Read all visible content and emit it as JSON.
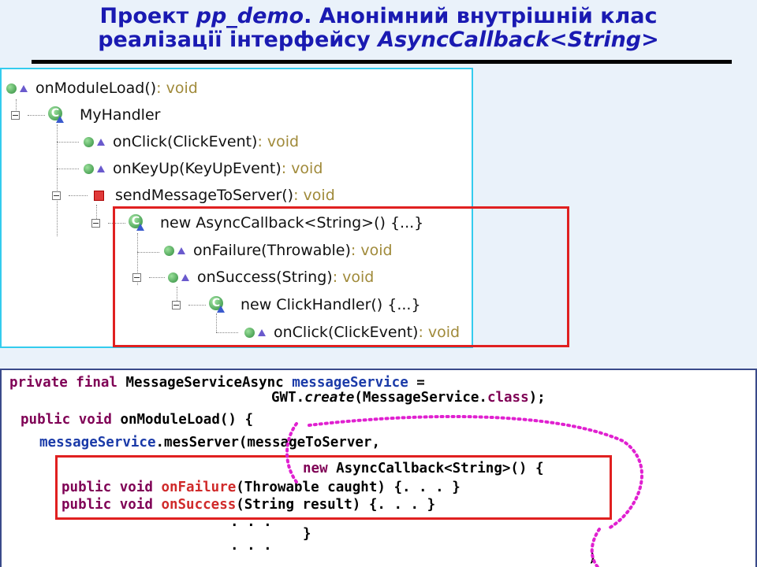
{
  "title": {
    "prefix": "Проект ",
    "project": "pp_demo",
    "line1_rest": ". Анонімний внутрішній клас",
    "line2_prefix": "реалізації інтерфейсу ",
    "iface": "AsyncCallback<String>"
  },
  "tree": {
    "root": {
      "label": "onModuleLoad()",
      "ret": " : void"
    },
    "handler": {
      "label": "MyHandler"
    },
    "onclick": {
      "label": "onClick(ClickEvent)",
      "ret": " : void"
    },
    "onkeyup": {
      "label": "onKeyUp(KeyUpEvent)",
      "ret": " : void"
    },
    "send": {
      "label": "sendMessageToServer()",
      "ret": " : void"
    },
    "async": {
      "label": "new AsyncCallback<String>() {...}"
    },
    "failure": {
      "label": "onFailure(Throwable)",
      "ret": " : void"
    },
    "success": {
      "label": "onSuccess(String)",
      "ret": " : void"
    },
    "clickhandler": {
      "label": "new ClickHandler() {...}"
    },
    "onclick2": {
      "label": "onClick(ClickEvent)",
      "ret": " : void"
    }
  },
  "code": {
    "l1_kw": "private final",
    "l1_type": " MessageServiceAsync ",
    "l1_field": "messageService",
    "l1_eq": " =",
    "l2_a": "GWT.",
    "l2_b": "create",
    "l2_c": "(MessageService.",
    "l2_d": "class",
    "l2_e": ");",
    "l3_kw": "public void",
    "l3_rest": " onModuleLoad() {",
    "l4_field": "messageService",
    "l4_rest": ".mesServer(messageToServer,",
    "l5_kw": "new",
    "l5_rest": " AsyncCallback<String>() {",
    "l6_kw": "public void",
    "l6_m": " onFailure",
    "l6_rest": "(Throwable caught) {. . . }",
    "l7_kw": "public void",
    "l7_m": " onSuccess",
    "l7_rest": "(String result) {. . . }",
    "l8": ". . .",
    "l8b": "}",
    "l9": ". . .",
    "l9b": ")"
  }
}
